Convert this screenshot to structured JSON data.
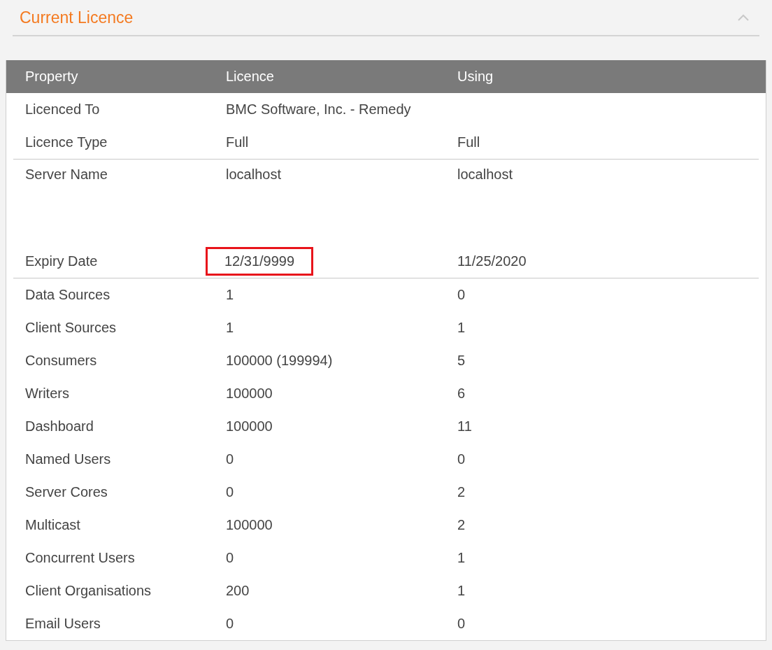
{
  "panel": {
    "title": "Current Licence",
    "expanded": true
  },
  "table": {
    "columns": [
      "Property",
      "Licence",
      "Using"
    ],
    "groups": [
      [
        {
          "kind": "normal",
          "property": "Licenced To",
          "licence": "BMC Software, Inc. - Remedy",
          "licence_highlighted": false
        },
        {
          "kind": "normal",
          "property": "Licence Type",
          "licence": "Full",
          "using": "Full",
          "licence_highlighted": false
        }
      ],
      [
        {
          "kind": "tall",
          "property": "Server Name",
          "licence": "localhost",
          "using": "localhost",
          "licence_highlighted": false
        },
        {
          "kind": "normal",
          "property": "Expiry Date",
          "licence": "12/31/9999",
          "using": "11/25/2020",
          "licence_highlighted": true
        }
      ],
      [
        {
          "kind": "normal",
          "property": "Data Sources",
          "licence": "1",
          "using": "0",
          "licence_highlighted": false
        },
        {
          "kind": "normal",
          "property": "Client Sources",
          "licence": "1",
          "using": "1",
          "licence_highlighted": false
        },
        {
          "kind": "normal",
          "property": "Consumers",
          "licence": "100000 (199994)",
          "using": "5",
          "licence_highlighted": false
        },
        {
          "kind": "normal",
          "property": "Writers",
          "licence": "100000",
          "using": "6",
          "licence_highlighted": false
        },
        {
          "kind": "normal",
          "property": "Dashboard",
          "licence": "100000",
          "using": "11",
          "licence_highlighted": false
        },
        {
          "kind": "normal",
          "property": "Named Users",
          "licence": "0",
          "using": "0",
          "licence_highlighted": false
        },
        {
          "kind": "normal",
          "property": "Server Cores",
          "licence": "0",
          "using": "2",
          "licence_highlighted": false
        },
        {
          "kind": "normal",
          "property": "Multicast",
          "licence": "100000",
          "using": "2",
          "licence_highlighted": false
        },
        {
          "kind": "normal",
          "property": "Concurrent Users",
          "licence": "0",
          "using": "1",
          "licence_highlighted": false
        },
        {
          "kind": "normal",
          "property": "Client Organisations",
          "licence": "200",
          "using": "1",
          "licence_highlighted": false
        },
        {
          "kind": "normal",
          "property": "Email Users",
          "licence": "0",
          "using": "0",
          "licence_highlighted": false
        }
      ]
    ]
  }
}
